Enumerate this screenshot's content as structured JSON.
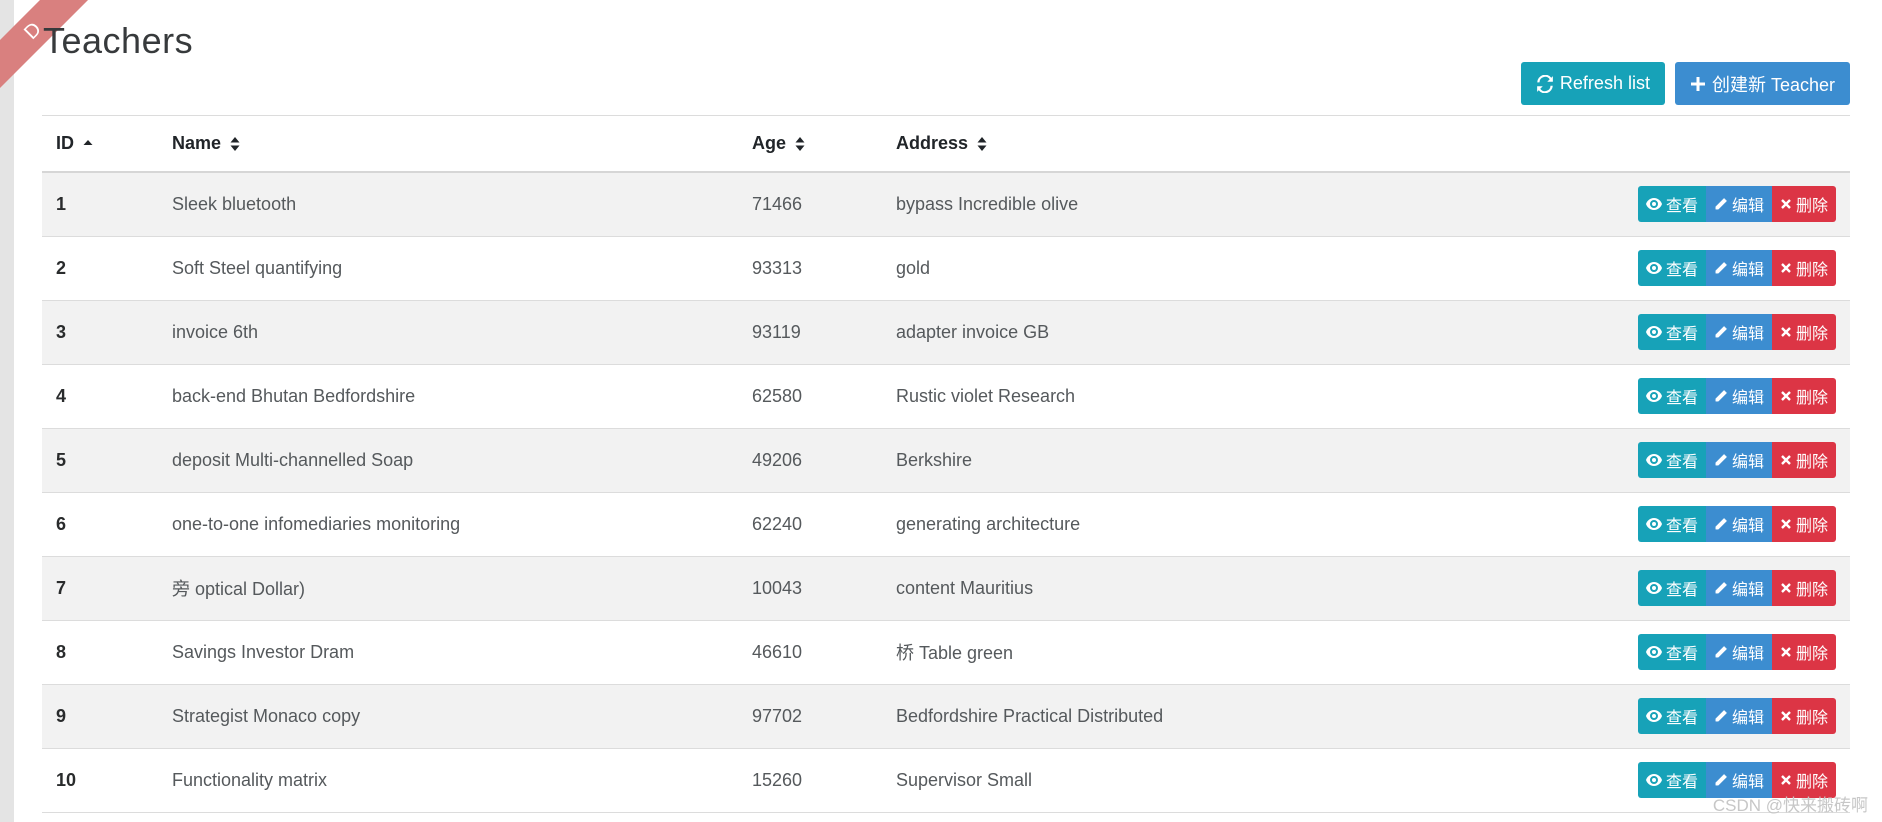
{
  "ribbon": {
    "text": "D"
  },
  "page": {
    "title": "Teachers"
  },
  "toolbar": {
    "refresh_label": "Refresh list",
    "create_label": "创建新 Teacher"
  },
  "table": {
    "headers": {
      "id": "ID",
      "name": "Name",
      "age": "Age",
      "address": "Address"
    },
    "rows": [
      {
        "id": "1",
        "name": "Sleek bluetooth",
        "age": "71466",
        "address": "bypass Incredible olive"
      },
      {
        "id": "2",
        "name": "Soft Steel quantifying",
        "age": "93313",
        "address": "gold"
      },
      {
        "id": "3",
        "name": "invoice 6th",
        "age": "93119",
        "address": "adapter invoice GB"
      },
      {
        "id": "4",
        "name": "back-end Bhutan Bedfordshire",
        "age": "62580",
        "address": "Rustic violet Research"
      },
      {
        "id": "5",
        "name": "deposit Multi-channelled Soap",
        "age": "49206",
        "address": "Berkshire"
      },
      {
        "id": "6",
        "name": "one-to-one infomediaries monitoring",
        "age": "62240",
        "address": "generating architecture"
      },
      {
        "id": "7",
        "name": "旁 optical Dollar)",
        "age": "10043",
        "address": "content Mauritius"
      },
      {
        "id": "8",
        "name": "Savings Investor Dram",
        "age": "46610",
        "address": "桥 Table green"
      },
      {
        "id": "9",
        "name": "Strategist Monaco copy",
        "age": "97702",
        "address": "Bedfordshire Practical Distributed"
      },
      {
        "id": "10",
        "name": "Functionality matrix",
        "age": "15260",
        "address": "Supervisor Small"
      }
    ],
    "actions": {
      "view": "查看",
      "edit": "编辑",
      "delete": "删除"
    }
  },
  "watermark": "CSDN @快来搬砖啊",
  "colors": {
    "info": "#17a2b8",
    "primary": "#3c8dd0",
    "danger": "#dc3545",
    "ribbon": "#d9807f"
  },
  "icons": {
    "refresh": "refresh-icon",
    "plus": "plus-icon",
    "view": "eye-icon",
    "edit": "pencil-icon",
    "delete": "x-icon",
    "sort": "sort-icon",
    "sort_asc": "sort-asc-icon"
  }
}
